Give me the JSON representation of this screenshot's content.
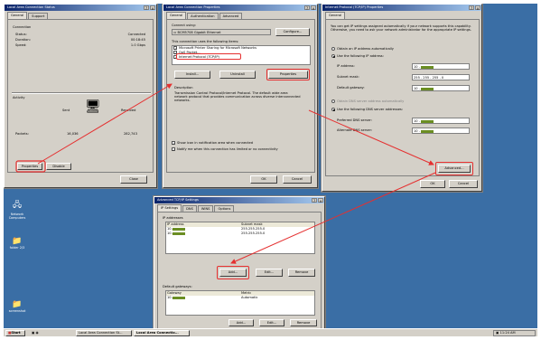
{
  "status_window": {
    "title": "Local Area Connection Status",
    "tabs": [
      "General",
      "Support"
    ],
    "connection_heading": "Connection",
    "status_label": "Status:",
    "status_value": "Connected",
    "duration_label": "Duration:",
    "duration_value": "00:18:45",
    "speed_label": "Speed:",
    "speed_value": "1.0 Gbps",
    "activity_heading": "Activity",
    "sent_label": "Sent",
    "received_label": "Received",
    "packets_label": "Packets:",
    "packets_sent": "16,036",
    "packets_received": "282,743",
    "properties_button": "Properties",
    "disable_button": "Disable",
    "close_button": "Close"
  },
  "props_window": {
    "title": "Local Area Connection Properties",
    "tabs": [
      "General",
      "Authentication",
      "Advanced"
    ],
    "connect_using_label": "Connect using:",
    "adapter": "BCM5708 Gigabit Ethernet",
    "configure_button": "Configure...",
    "items_label": "This connection uses the following items:",
    "items": [
      "Microsoft Printer Sharing for Microsoft Networks",
      "QoS Packet...",
      "Internet Protocol (TCP/IP)"
    ],
    "install_button": "Install...",
    "uninstall_button": "Uninstall",
    "properties_button": "Properties",
    "description_heading": "Description",
    "description_text": "Transmission Control Protocol/Internet Protocol. The default wide area network protocol that provides communication across diverse interconnected networks.",
    "show_icon_label": "Show icon in notification area when connected",
    "notify_label": "Notify me when this connection has limited or no connectivity",
    "ok_button": "OK",
    "cancel_button": "Cancel"
  },
  "tcpip_window": {
    "title": "Internet Protocol (TCP/IP) Properties",
    "tabs": [
      "General"
    ],
    "intro_text": "You can get IP settings assigned automatically if your network supports this capability. Otherwise, you need to ask your network administrator for the appropriate IP settings.",
    "auto_ip_label": "Obtain an IP address automatically",
    "use_ip_label": "Use the following IP address:",
    "ip_label": "IP address:",
    "ip_value": "10",
    "subnet_label": "Subnet mask:",
    "subnet_value": "255 . 255 . 255 . 0",
    "gateway_label": "Default gateway:",
    "gateway_value": "10",
    "auto_dns_label": "Obtain DNS server address automatically",
    "use_dns_label": "Use the following DNS server addresses:",
    "pref_dns_label": "Preferred DNS server:",
    "pref_dns_value": "10",
    "alt_dns_label": "Alternate DNS server:",
    "alt_dns_value": "10",
    "advanced_button": "Advanced...",
    "ok_button": "OK",
    "cancel_button": "Cancel"
  },
  "advanced_window": {
    "title": "Advanced TCP/IP Settings",
    "tabs": [
      "IP Settings",
      "DNS",
      "WINS",
      "Options"
    ],
    "ip_heading": "IP addresses",
    "col_ip": "IP address",
    "col_subnet": "Subnet mask",
    "ip_rows": [
      {
        "ip": "10.",
        "mask": "255.255.255.0"
      },
      {
        "ip": "10.",
        "mask": "255.255.255.0"
      }
    ],
    "add_button": "Add...",
    "edit_button": "Edit...",
    "remove_button": "Remove",
    "gateway_heading": "Default gateways:",
    "col_gateway": "Gateway",
    "col_metric": "Metric",
    "gateway_rows": [
      {
        "gateway": "10.",
        "metric": "Automatic"
      }
    ],
    "add2_button": "Add...",
    "edit2_button": "Edit...",
    "remove2_button": "Remove"
  },
  "desktop": {
    "icons": [
      {
        "label": "Network Computers",
        "glyph": "🖧"
      },
      {
        "label": "folder 2/3",
        "glyph": "📁"
      },
      {
        "label": "screenshot",
        "glyph": "📁"
      }
    ]
  },
  "taskbar": {
    "start_label": "Start",
    "tasks": [
      "Local Area Connection St...",
      "Local Area Connectio..."
    ],
    "clock": "11:24 AM"
  },
  "colors": {
    "highlight": "#e53030",
    "desktop": "#3a6ea5",
    "title_start": "#0a246a"
  }
}
